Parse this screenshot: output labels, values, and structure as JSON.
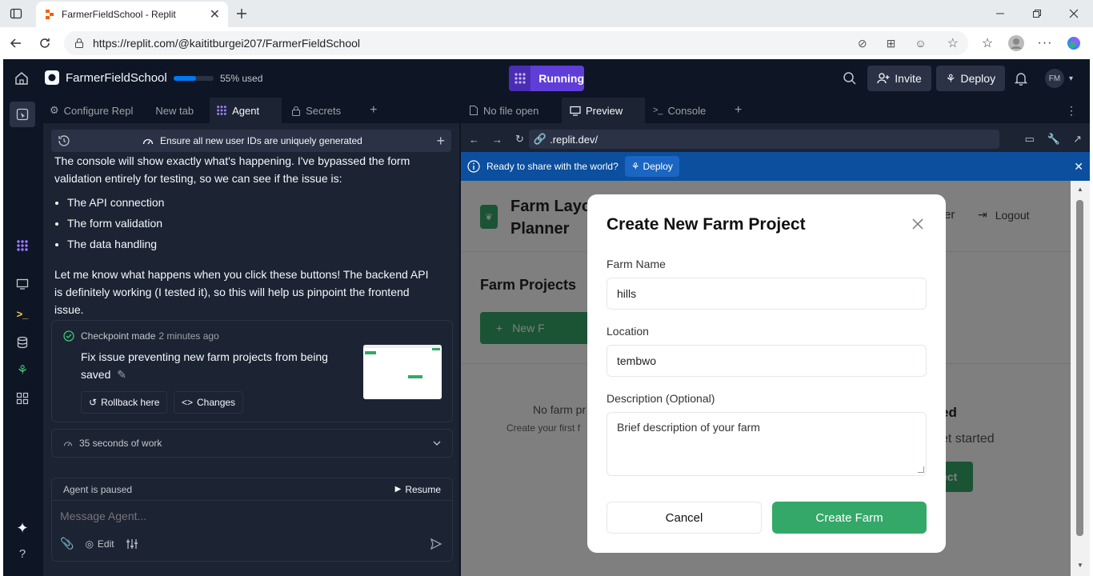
{
  "browser": {
    "tab_title": "FarmerFieldSchool - Replit",
    "url": "https://replit.com/@kaititburgei207/FarmerFieldSchool"
  },
  "topbar": {
    "project_name": "FarmerFieldSchool",
    "usage_text": "55% used",
    "usage_fraction": 0.55,
    "run_label": "Running",
    "invite_label": "Invite",
    "deploy_label": "Deploy",
    "avatar_initials": "FM"
  },
  "left_tabs": [
    {
      "label": "Configure Repl"
    },
    {
      "label": "New tab"
    },
    {
      "label": "Agent"
    },
    {
      "label": "Secrets"
    }
  ],
  "chat": {
    "header_title": "Ensure all new user IDs are uniquely generated",
    "para1": "The console will show exactly what's happening. I've bypassed the form validation entirely for testing, so we can see if the issue is:",
    "bullets": [
      "The API connection",
      "The form validation",
      "The data handling"
    ],
    "para2": "Let me know what happens when you click these buttons! The backend API is definitely working (I tested it), so this will help us pinpoint the frontend issue.",
    "checkpoint_label": "Checkpoint made",
    "checkpoint_time": "2 minutes ago",
    "checkpoint_desc": "Fix issue preventing new farm projects from being saved",
    "rollback_label": "Rollback here",
    "changes_label": "Changes",
    "work_summary": "35 seconds of work",
    "paused_text": "Agent is paused",
    "resume_label": "Resume",
    "message_placeholder": "Message Agent...",
    "edit_label": "Edit"
  },
  "right_tabs": [
    {
      "label": "No file open"
    },
    {
      "label": "Preview"
    },
    {
      "label": "Console"
    }
  ],
  "preview": {
    "url": ".replit.dev/",
    "banner_text": "Ready to share with the world?",
    "banner_deploy": "Deploy"
  },
  "farm_app": {
    "brand_line1": "Farm Layo",
    "brand_line2": "Planner",
    "header_right_partial": "er",
    "logout_label": "Logout",
    "projects_title": "Farm Projects",
    "new_button_partial": "New F",
    "empty_partial": "No farm pr",
    "empty_sub_partial": "Create your first f",
    "right_partial_1": "ed",
    "right_partial_2": "et started",
    "right_partial_3": "ect"
  },
  "modal": {
    "title": "Create New Farm Project",
    "farm_name_label": "Farm Name",
    "farm_name_value": "hills",
    "location_label": "Location",
    "location_value": "tembwo",
    "description_label": "Description (Optional)",
    "description_placeholder": "Brief description of your farm",
    "cancel_label": "Cancel",
    "create_label": "Create Farm"
  },
  "colors": {
    "accent_green": "#34a868",
    "running_purple": "#5f3ed8",
    "banner_blue": "#0b4f9e",
    "ide_bg": "#0e1525",
    "panel_bg": "#1c2333"
  }
}
